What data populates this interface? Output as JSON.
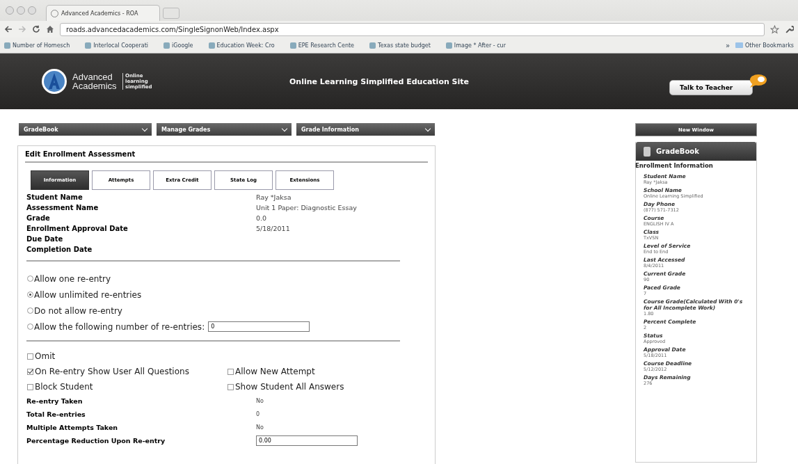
{
  "browser": {
    "tab_title": "Advanced Academics - ROA",
    "url": "roads.advancedacademics.com/SingleSignonWeb/Index.aspx",
    "bookmarks": [
      "Number of Homesch",
      "Interlocal Cooperati",
      "iGoogle",
      "Education Week: Cro",
      "EPE Research Cente",
      "Texas state budget",
      "Image * After - cur"
    ],
    "overflow": "»",
    "other_bookmarks": "Other Bookmarks"
  },
  "header": {
    "logo_name": "Advanced Academics",
    "tagline": "Online learning simplified",
    "site_title": "Online Learning Simplified Education Site",
    "talk_button": "Talk to Teacher"
  },
  "menus": [
    {
      "label": "GradeBook"
    },
    {
      "label": "Manage Grades"
    },
    {
      "label": "Grade Information"
    }
  ],
  "panel": {
    "title": "Edit Enrollment Assessment",
    "tabs": [
      {
        "label": "Information",
        "selected": true
      },
      {
        "label": "Attempts",
        "selected": false
      },
      {
        "label": "Extra Credit",
        "selected": false
      },
      {
        "label": "State Log",
        "selected": false
      },
      {
        "label": "Extensions",
        "selected": false
      }
    ],
    "info": [
      {
        "label": "Student Name",
        "value": "Ray *Jaksa"
      },
      {
        "label": "Assessment Name",
        "value": "Unit 1 Paper: Diagnostic Essay"
      },
      {
        "label": "Grade",
        "value": "0.0"
      },
      {
        "label": "Enrollment Approval Date",
        "value": "5/18/2011"
      },
      {
        "label": "Due Date"
      },
      {
        "label": "Completion Date"
      }
    ],
    "reentry_options": [
      {
        "label": "Allow one re-entry",
        "selected": false
      },
      {
        "label": "Allow unlimited re-entries",
        "selected": true
      },
      {
        "label": "Do not allow re-entry",
        "selected": false
      },
      {
        "label": "Allow the following number of re-entries:",
        "selected": false,
        "field_value": "0"
      }
    ],
    "checkbox_rows": [
      {
        "items": [
          {
            "label": "Omit",
            "checked": false
          }
        ]
      },
      {
        "items": [
          {
            "label": "On Re-entry Show User All Questions",
            "checked": true
          },
          {
            "label": "Allow New Attempt",
            "checked": false
          }
        ]
      },
      {
        "items": [
          {
            "label": "Block Student",
            "checked": false
          },
          {
            "label": "Show Student All Answers",
            "checked": false
          }
        ]
      }
    ],
    "stats": [
      {
        "label": "Re-entry Taken",
        "value": "No"
      },
      {
        "label": "Total Re-entries",
        "value": "0"
      },
      {
        "label": "Multiple Attempts Taken",
        "value": "No"
      },
      {
        "label": "Percentage Reduction Upon Re-entry",
        "field_value": "0.00"
      }
    ]
  },
  "sidebar": {
    "button": "New Window",
    "title": "GradeBook",
    "section": "Enrollment Information",
    "fields": [
      {
        "label": "Student Name",
        "value": "Ray *Jaksa"
      },
      {
        "label": "School Name",
        "value": "Online Learning Simplified"
      },
      {
        "label": "Day Phone",
        "value": "(877) 571-7312"
      },
      {
        "label": "Course",
        "value": "ENGLISH IV A"
      },
      {
        "label": "Class",
        "value": "TxVSN"
      },
      {
        "label": "Level of Service",
        "value": "End to End"
      },
      {
        "label": "Last Accessed",
        "value": "8/4/2011"
      },
      {
        "label": "Current Grade",
        "value": "90"
      },
      {
        "label": "Paced Grade",
        "value": "7"
      },
      {
        "label": "Course Grade(Calculated With 0's for All Incomplete Work)",
        "value": "1.80"
      },
      {
        "label": "Percent Complete",
        "value": "2"
      },
      {
        "label": "Status",
        "value": "Approved"
      },
      {
        "label": "Approval Date",
        "value": "5/18/2011"
      },
      {
        "label": "Course Deadline",
        "value": "5/12/2012"
      },
      {
        "label": "Days Remaining",
        "value": "276"
      }
    ]
  }
}
